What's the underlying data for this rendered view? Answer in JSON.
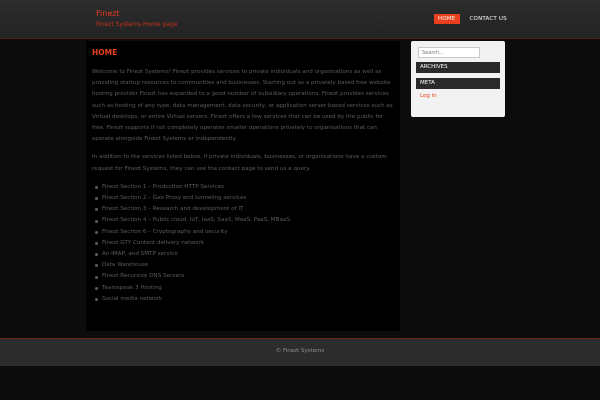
{
  "site": {
    "title": "Finezt",
    "description": "Finezt Systems Home page"
  },
  "nav": {
    "items": [
      {
        "label": "HOME",
        "active": true
      },
      {
        "label": "CONTACT US",
        "active": false
      }
    ]
  },
  "main": {
    "title": "HOME",
    "paragraphs": [
      "Welcome to Finezt Systems! Finezt provides services to private individuals and organisations as well as providing startup resources to communities and businesses. Starting out as a privately based free website hosting provider Finezt has expanded to a good number of subsidiary operations. Finezt provides services such as hosting of any type, data management, data security, or application server based services such as Virtual desktops, or entire Virtual servers. Finezt offers a few services that can be used by the public for free. Finezt supports if not completely operates smaller operations privately to organisations that can operate alongside Finezt Systems or independently.",
      "In addition to the services listed below, if private individuals, businesses, or organisations have a custom request for Finezt Systems, they can use the contact page to send us a query."
    ],
    "services": [
      "Finezt Section 1 – Production HTTP Services",
      "Finezt Section 2 – Geo Proxy and tunneling services",
      "Finezt Section 3 – Research and development of IT",
      "Finezt Section 4 – Public cloud, IoT, IaaS, SaaS, MaaS, PaaS, MBaaS",
      "Finezt Section 6 – Cryptography and security",
      "Finezt GTY Content delivery network",
      "An IMAP, and SMTP service",
      "Data Warehouse",
      "Finezt Recursive DNS Servers",
      "Teamspeak 3 Hosting",
      "Social media network"
    ]
  },
  "sidebar": {
    "search_placeholder": "Search...",
    "archives_title": "ARCHIVES",
    "meta_title": "META",
    "login_link": "Log in"
  },
  "footer": {
    "text": "© Finezt Systems"
  },
  "colors": {
    "accent": "#e8401f",
    "header_bg": "#2c2c2c",
    "body_bg": "#0c0c0c"
  }
}
